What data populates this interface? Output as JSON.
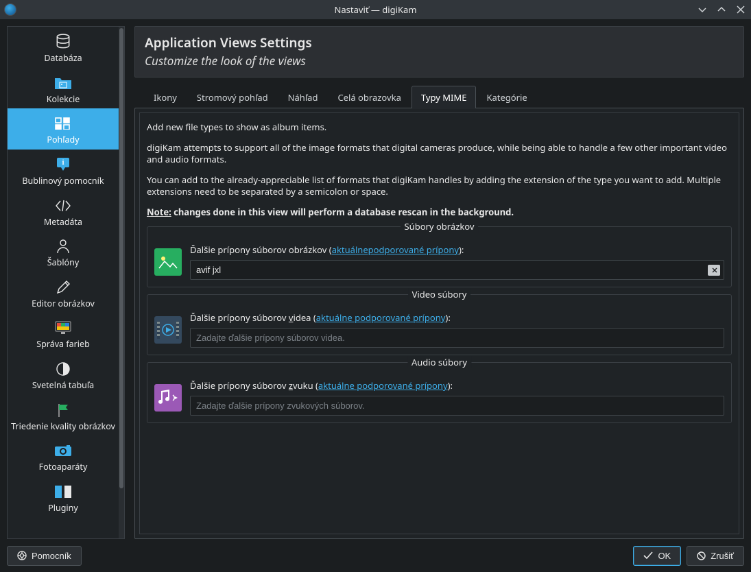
{
  "window": {
    "title": "Nastaviť — digiKam"
  },
  "sidebar": {
    "items": [
      {
        "label": "Databáza"
      },
      {
        "label": "Kolekcie"
      },
      {
        "label": "Pohľady"
      },
      {
        "label": "Bublinový pomocník"
      },
      {
        "label": "Metadáta"
      },
      {
        "label": "Šablóny"
      },
      {
        "label": "Editor obrázkov"
      },
      {
        "label": "Správa farieb"
      },
      {
        "label": "Svetelná tabuľa"
      },
      {
        "label": "Triedenie kvality obrázkov"
      },
      {
        "label": "Fotoaparáty"
      },
      {
        "label": "Pluginy"
      }
    ]
  },
  "header": {
    "title": "Application Views Settings",
    "subtitle": "Customize the look of the views"
  },
  "tabs": [
    {
      "label": "Ikony"
    },
    {
      "label": "Stromový pohľad"
    },
    {
      "label": "Náhľad"
    },
    {
      "label": "Celá obrazovka"
    },
    {
      "label": "Typy MIME"
    },
    {
      "label": "Kategórie"
    }
  ],
  "mime": {
    "intro1": "Add new file types to show as album items.",
    "intro2": "digiKam attempts to support all of the image formats that digital cameras produce, while being able to handle a few other important video and audio formats.",
    "intro3": "You can add to the already-appreciable list of formats that digiKam handles by adding the extension of the type you want to add. Multiple extensions need to be separated by a semicolon or space.",
    "note_label": "Note:",
    "note_rest": " changes done in this view will perform a database rescan in the background.",
    "image": {
      "group_title": "Súbory obrázkov",
      "label_pre": "Ďalšie prípony súborov obrázkov (",
      "link": "aktuálnepodporované prípony",
      "label_post": "):",
      "value": "avif jxl"
    },
    "video": {
      "group_title": "Video súbory",
      "label_pre": "Ďalšie prípony súborov ",
      "label_u": "v",
      "label_mid": "idea (",
      "link": "aktuálne podporované prípony",
      "label_post": "):",
      "placeholder": "Zadajte ďalšie prípony súborov videa."
    },
    "audio": {
      "group_title": "Audio súbory",
      "label_pre": "Ďalšie prípony súborov ",
      "label_u": "z",
      "label_mid": "vuku (",
      "link": "aktuálne podporované prípony",
      "label_post": "):",
      "placeholder": "Zadajte ďalšie prípony zvukových súborov."
    }
  },
  "footer": {
    "help": "Pomocník",
    "ok": "OK",
    "cancel": "Zrušiť"
  }
}
